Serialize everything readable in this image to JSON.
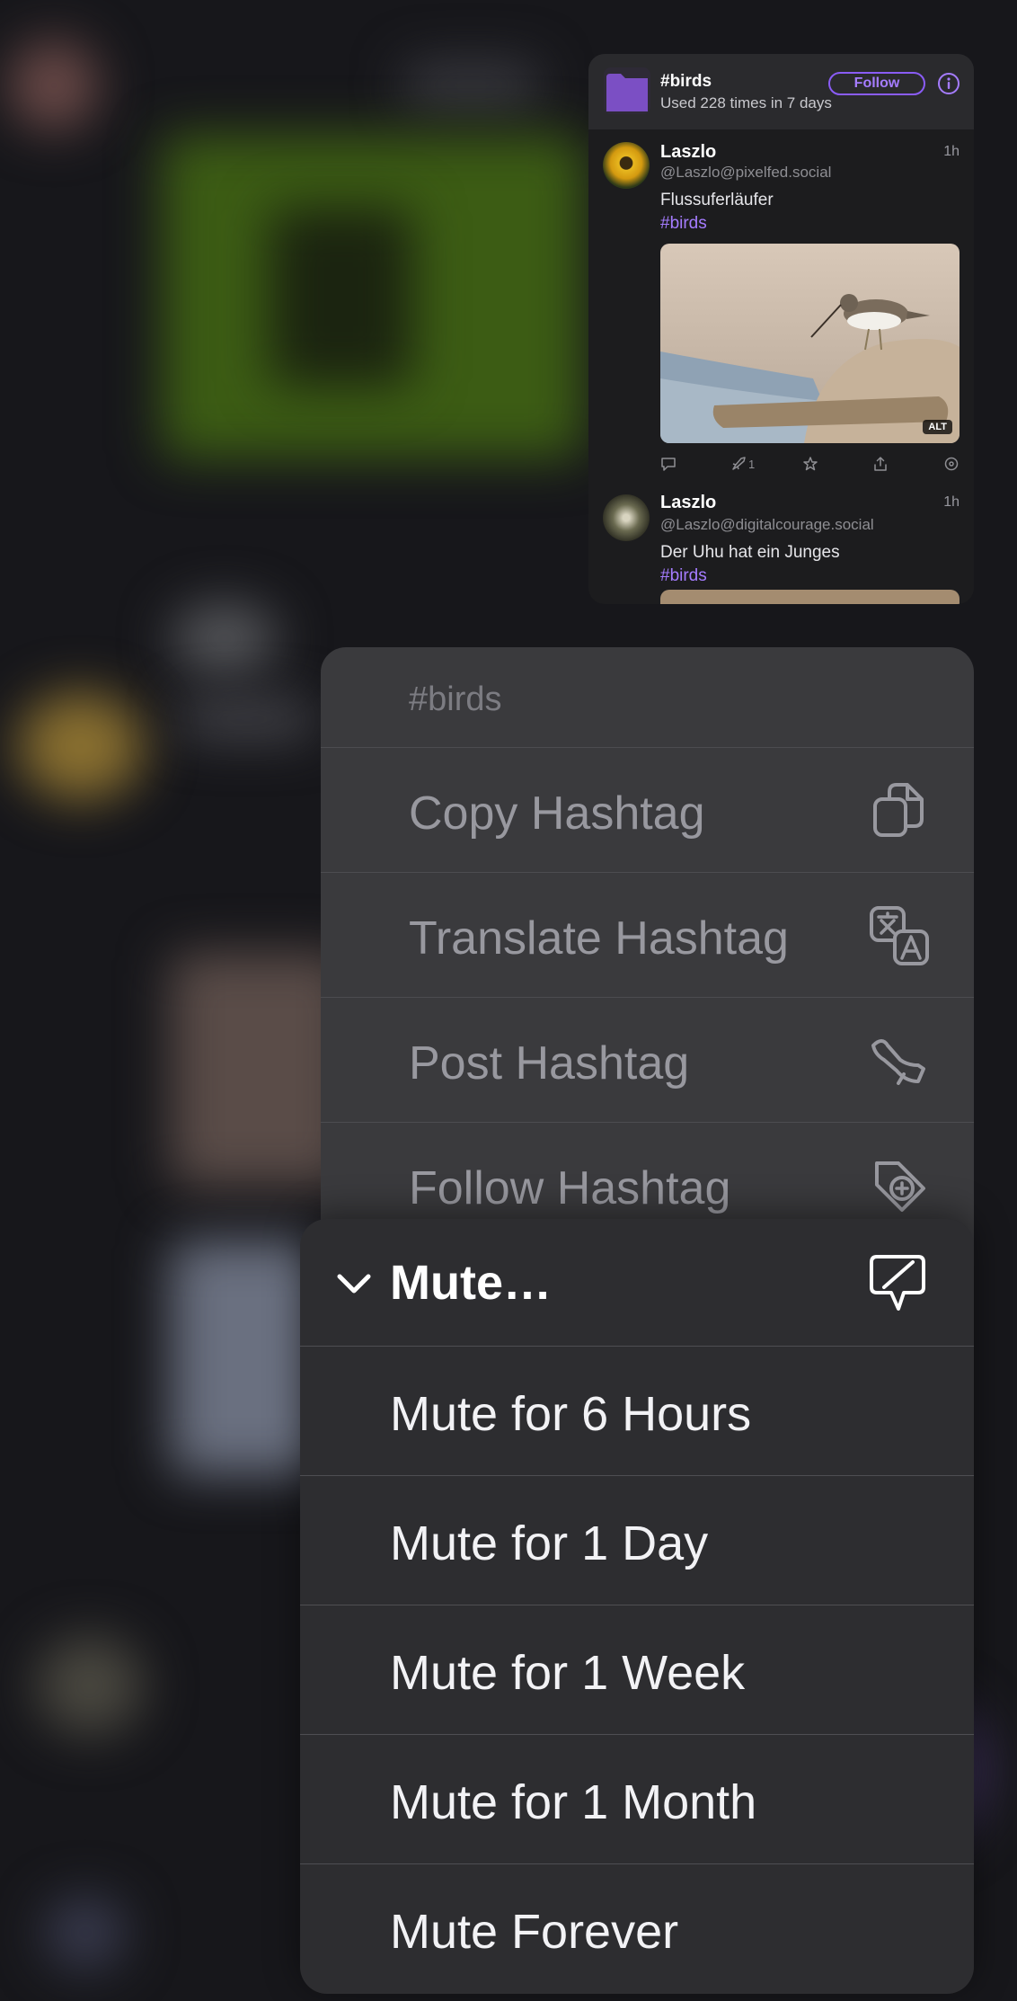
{
  "preview": {
    "hashtag": "#birds",
    "usage": "Used 228 times in 7 days",
    "follow_label": "Follow",
    "posts": [
      {
        "author": "Laszlo",
        "handle": "@Laszlo@pixelfed.social",
        "time": "1h",
        "text": "Flussuferläufer",
        "tag": "#birds",
        "alt_badge": "ALT",
        "boost_count": "1"
      },
      {
        "author": "Laszlo",
        "handle": "@Laszlo@digitalcourage.social",
        "time": "1h",
        "text": "Der Uhu hat ein Junges",
        "tag": "#birds"
      }
    ]
  },
  "context_menu": {
    "title": "#birds",
    "items": [
      {
        "label": "Copy Hashtag",
        "icon": "copy-icon"
      },
      {
        "label": "Translate Hashtag",
        "icon": "translate-icon"
      },
      {
        "label": "Post Hashtag",
        "icon": "megaphone-icon"
      },
      {
        "label": "Follow Hashtag",
        "icon": "tag-plus-icon"
      }
    ]
  },
  "mute_menu": {
    "title": "Mute…",
    "icon": "mute-bubble-icon",
    "options": [
      "Mute for 6 Hours",
      "Mute for 1 Day",
      "Mute for 1 Week",
      "Mute for 1 Month",
      "Mute Forever"
    ]
  },
  "colors": {
    "accent": "#8a5cf6",
    "menu_back": "#3a3a3d",
    "menu_front": "#2d2d30"
  }
}
